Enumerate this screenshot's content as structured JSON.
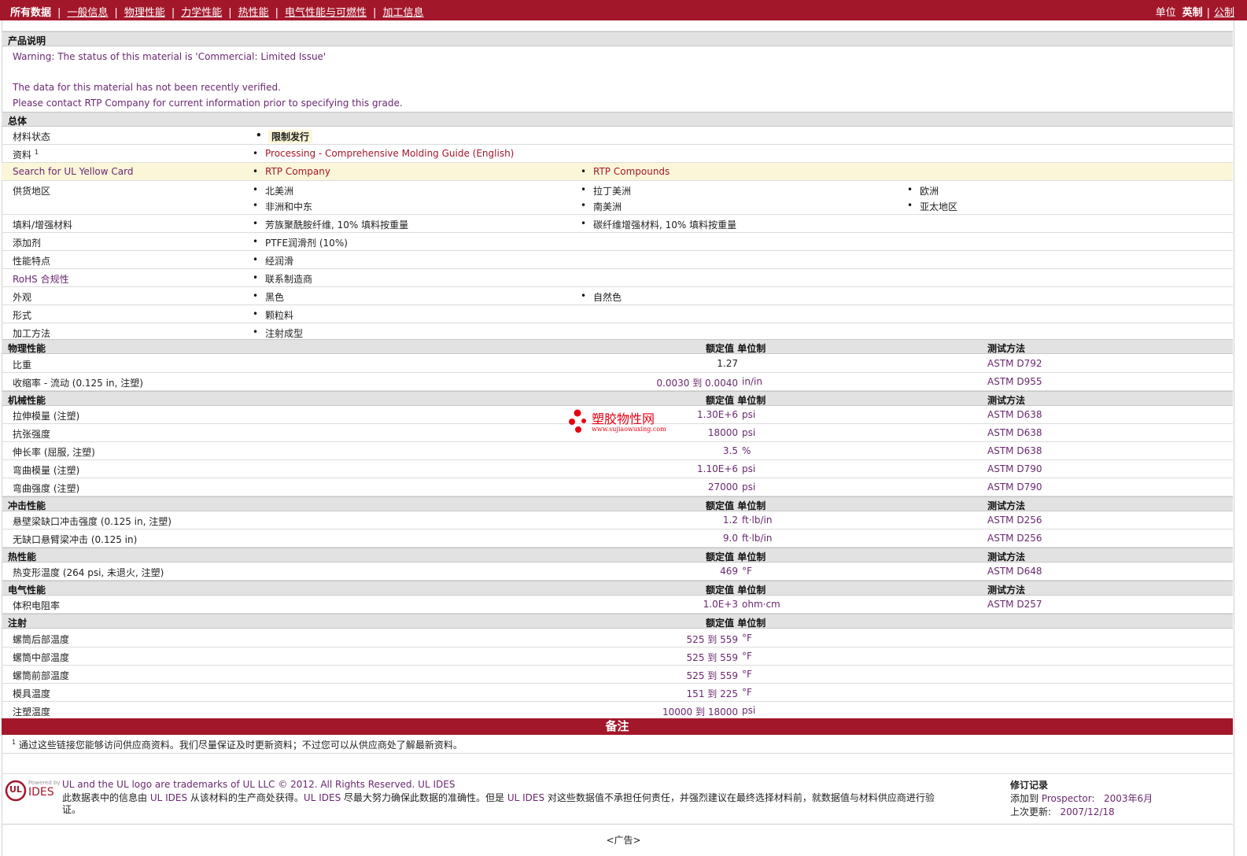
{
  "nav": {
    "items": [
      "所有数据",
      "一般信息",
      "物理性能",
      "力学性能",
      "热性能",
      "电气性能与可燃性",
      "加工信息"
    ],
    "units_label": "单位",
    "unit_current": "英制",
    "unit_other": "公制"
  },
  "product": {
    "header": "产品说明",
    "line1": "Warning: The status of this material is 'Commercial: Limited Issue'",
    "line2": "The data for this material has not been recently verified.",
    "line3": "Please contact RTP Company for current information prior to specifying this grade."
  },
  "general": {
    "header": "总体",
    "rows": [
      {
        "label": "材料状态",
        "values": [
          "限制发行"
        ]
      },
      {
        "label": "资料",
        "sup": "1",
        "values": [
          "Processing - Comprehensive Molding Guide (English)"
        ]
      },
      {
        "label": "Search for UL Yellow Card",
        "values": [
          "RTP Company",
          "RTP Compounds"
        ]
      },
      {
        "label": "供货地区",
        "values": [
          "北美洲",
          "拉丁美洲",
          "欧洲",
          "非洲和中东",
          "南美洲",
          "亚太地区"
        ]
      },
      {
        "label": "填料/增强材料",
        "values": [
          "芳族聚酰胺纤维, 10% 填料按重量",
          "碳纤维增强材料, 10% 填料按重量"
        ]
      },
      {
        "label": "添加剂",
        "values": [
          "PTFE润滑剂 (10%)"
        ]
      },
      {
        "label": "性能特点",
        "values": [
          "经润滑"
        ]
      },
      {
        "label": "RoHS 合规性",
        "values": [
          "联系制造商"
        ]
      },
      {
        "label": "外观",
        "values": [
          "黑色",
          "自然色"
        ]
      },
      {
        "label": "形式",
        "values": [
          "颗粒料"
        ]
      },
      {
        "label": "加工方法",
        "values": [
          "注射成型"
        ]
      }
    ]
  },
  "col_headers": {
    "nominal": "额定值",
    "unit": "单位制",
    "method": "测试方法"
  },
  "physical": {
    "header": "物理性能",
    "rows": [
      {
        "label": "比重",
        "value": "1.27",
        "unit": "",
        "method": "ASTM D792"
      },
      {
        "label": "收缩率 - 流动 (0.125 in, 注塑)",
        "value": "0.0030 到  0.0040",
        "unit": "in/in",
        "method": "ASTM D955"
      }
    ]
  },
  "mechanical": {
    "header": "机械性能",
    "rows": [
      {
        "label": "拉伸模量 (注塑)",
        "value": "1.30E+6",
        "unit": "psi",
        "method": "ASTM D638"
      },
      {
        "label": "抗张强度",
        "value": "18000",
        "unit": "psi",
        "method": "ASTM D638"
      },
      {
        "label": "伸长率 (屈服, 注塑)",
        "value": "3.5",
        "unit": "%",
        "method": "ASTM D638"
      },
      {
        "label": "弯曲模量 (注塑)",
        "value": "1.10E+6",
        "unit": "psi",
        "method": "ASTM D790"
      },
      {
        "label": "弯曲强度 (注塑)",
        "value": "27000",
        "unit": "psi",
        "method": "ASTM D790"
      }
    ]
  },
  "impact": {
    "header": "冲击性能",
    "rows": [
      {
        "label": "悬壁梁缺口冲击强度 (0.125 in, 注塑)",
        "value": "1.2",
        "unit": "ft·lb/in",
        "method": "ASTM D256"
      },
      {
        "label": "无缺口悬臂梁冲击 (0.125 in)",
        "value": "9.0",
        "unit": "ft·lb/in",
        "method": "ASTM D256"
      }
    ]
  },
  "thermal": {
    "header": "热性能",
    "rows": [
      {
        "label": "热变形温度 (264 psi, 未退火, 注塑)",
        "value": "469",
        "unit": "°F",
        "method": "ASTM D648"
      }
    ]
  },
  "electrical": {
    "header": "电气性能",
    "rows": [
      {
        "label": "体积电阻率",
        "value": "1.0E+3",
        "unit": "ohm·cm",
        "method": "ASTM D257"
      }
    ]
  },
  "injection": {
    "header": "注射",
    "rows": [
      {
        "label": "螺筒后部温度",
        "value": "525 到  559",
        "unit": "°F"
      },
      {
        "label": "螺筒中部温度",
        "value": "525 到  559",
        "unit": "°F"
      },
      {
        "label": "螺筒前部温度",
        "value": "525 到  559",
        "unit": "°F"
      },
      {
        "label": "模具温度",
        "value": "151 到  225",
        "unit": "°F"
      },
      {
        "label": "注塑温度",
        "value": "10000 到  18000",
        "unit": "psi"
      }
    ]
  },
  "watermark": {
    "title": "塑胶物性网",
    "url": "www.sujiaowuxing.com"
  },
  "notes": {
    "header": "备注",
    "sup": "1",
    "text": "通过这些链接您能够访问供应商资料。我们尽量保证及时更新资料；不过您可以从供应商处了解最新资料。"
  },
  "footer": {
    "logo_powered": "Powered by",
    "logo_ul": "UL",
    "logo_ides": "IDES",
    "trademark": "UL and the UL logo are trademarks of UL LLC © 2012. All Rights Reserved. UL IDES",
    "disclaimer_a": "此数据表中的信息由 ",
    "disclaimer_b": "UL IDES",
    "disclaimer_c": " 从该材料的生产商处获得。",
    "disclaimer_d": "UL IDES",
    "disclaimer_e": " 尽最大努力确保此数据的准确性。但是 ",
    "disclaimer_f": "UL IDES",
    "disclaimer_g": " 对这些数据值不承担任何责任，并强烈建议在最终选择材料前，就数据值与材料供应商进行验",
    "disclaimer_h": "证。",
    "rev_title": "修订记录",
    "added_label": "添加到",
    "added_target": "Prospector:",
    "added_date": "2003年6月",
    "updated_label": "上次更新:",
    "updated_date": "2007/12/18",
    "ad": "<广告>"
  },
  "colors": {
    "brand": "#a3172b",
    "header_bg": "#e2e2e2",
    "highlight": "#fbf6d8",
    "purple": "#6b2872"
  }
}
